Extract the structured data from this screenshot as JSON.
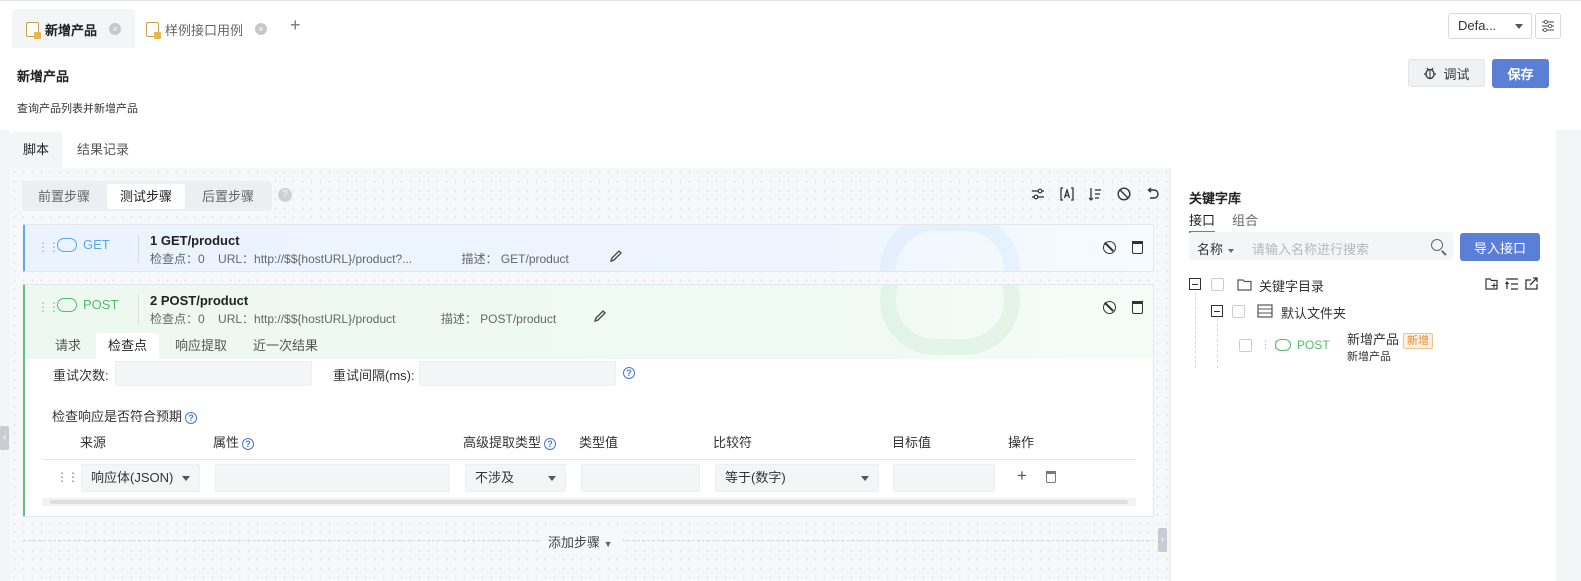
{
  "file_tabs": [
    {
      "label": "新增产品",
      "active": true
    },
    {
      "label": "样例接口用例",
      "active": false
    }
  ],
  "env": {
    "selected": "Defa..."
  },
  "header": {
    "title": "新增产品",
    "description": "查询产品列表并新增产品",
    "debug_label": "调试",
    "save_label": "保存"
  },
  "main_tabs": [
    {
      "label": "脚本",
      "active": true
    },
    {
      "label": "结果记录",
      "active": false
    }
  ],
  "step_tabs": [
    {
      "label": "前置步骤",
      "active": false
    },
    {
      "label": "测试步骤",
      "active": true
    },
    {
      "label": "后置步骤",
      "active": false
    }
  ],
  "steps": [
    {
      "method": "GET",
      "title": "1   GET/product",
      "checkpoint": "检查点：0",
      "url": "URL：http://$${hostURL}/product?...",
      "desc": "描述：  GET/product",
      "color": "#5aa6ee"
    },
    {
      "method": "POST",
      "title": "2   POST/product",
      "checkpoint": "检查点：0",
      "url": "URL：http://$${hostURL}/product",
      "desc": "描述：  POST/product",
      "color": "#52bb6e"
    }
  ],
  "step_detail": {
    "tabs": [
      {
        "label": "请求",
        "active": false
      },
      {
        "label": "检查点",
        "active": true
      },
      {
        "label": "响应提取",
        "active": false
      },
      {
        "label": "近一次结果",
        "active": false
      }
    ],
    "retry_count_label": "重试次数:",
    "retry_interval_label": "重试间隔(ms):",
    "section_title": "检查响应是否符合预期",
    "columns": [
      "来源",
      "属性",
      "高级提取类型",
      "类型值",
      "比较符",
      "目标值",
      "操作"
    ],
    "row": {
      "source": "响应体(JSON)",
      "property": "",
      "extract_type": "不涉及",
      "type_value": "",
      "comparator": "等于(数字)",
      "target": ""
    }
  },
  "add_step_label": "添加步骤",
  "keyword_lib": {
    "title": "关键字库",
    "tabs": [
      {
        "label": "接口",
        "active": true
      },
      {
        "label": "组合",
        "active": false
      }
    ],
    "search_field": "名称",
    "search_placeholder": "请输入名称进行搜索",
    "import_label": "导入接口",
    "tree": {
      "root": "关键字目录",
      "folder": "默认文件夹",
      "item_method": "POST",
      "item_name": "新增产品",
      "item_badge": "新增",
      "item_desc": "新增产品"
    }
  },
  "colors": {
    "accent": "#5b7fd6",
    "get": "#5aa6ee",
    "post": "#52bb6e",
    "badge": "#e8892f"
  }
}
